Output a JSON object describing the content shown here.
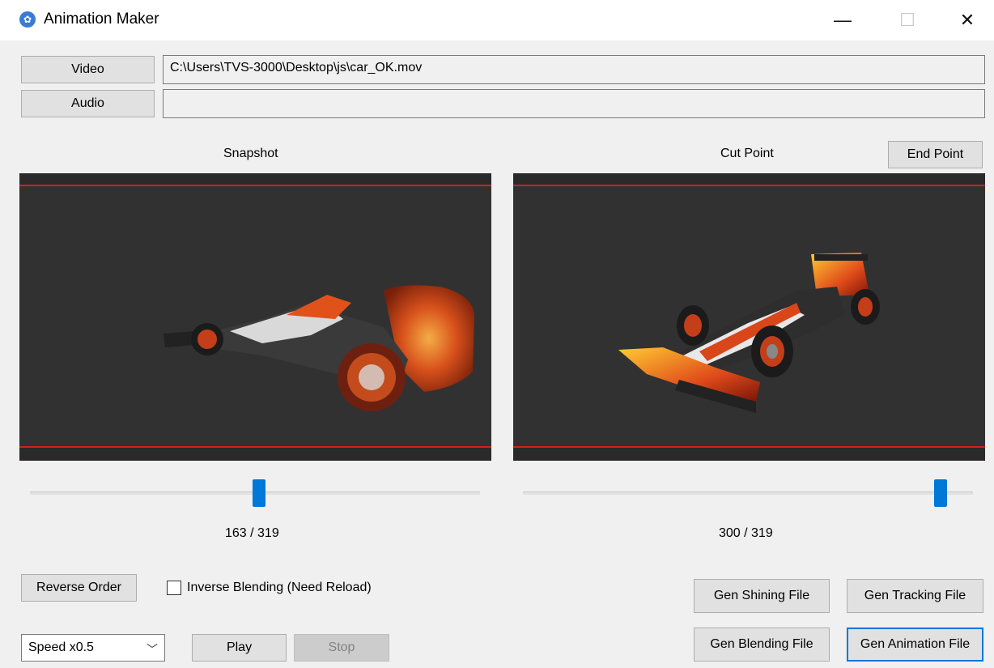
{
  "window": {
    "title": "Animation Maker",
    "icon": "film-reel-icon",
    "controls": {
      "minimize": "—",
      "maximize": "☐",
      "close": "✕"
    }
  },
  "sources": {
    "video_button": "Video",
    "video_path": "C:\\Users\\TVS-3000\\Desktop\\js\\car_OK.mov",
    "audio_button": "Audio",
    "audio_path": ""
  },
  "snapshot": {
    "label": "Snapshot",
    "position_text": "163 / 319",
    "slider_fraction": 0.51
  },
  "cut_point": {
    "label": "Cut Point",
    "end_point_button": "End Point",
    "position_text": "300 / 319",
    "slider_fraction": 0.94
  },
  "options": {
    "reverse_order_button": "Reverse Order",
    "inverse_blending_label": "Inverse Blending (Need Reload)",
    "inverse_blending_checked": false
  },
  "playback": {
    "speed_selected": "Speed x0.5",
    "play_button": "Play",
    "stop_button": "Stop"
  },
  "generate": {
    "shining": "Gen Shining File",
    "tracking": "Gen Tracking File",
    "blending": "Gen Blending File",
    "animation": "Gen Animation File"
  },
  "colors": {
    "accent": "#0078d7",
    "frame_border": "#d02020",
    "video_bg": "#2a2a2a"
  }
}
